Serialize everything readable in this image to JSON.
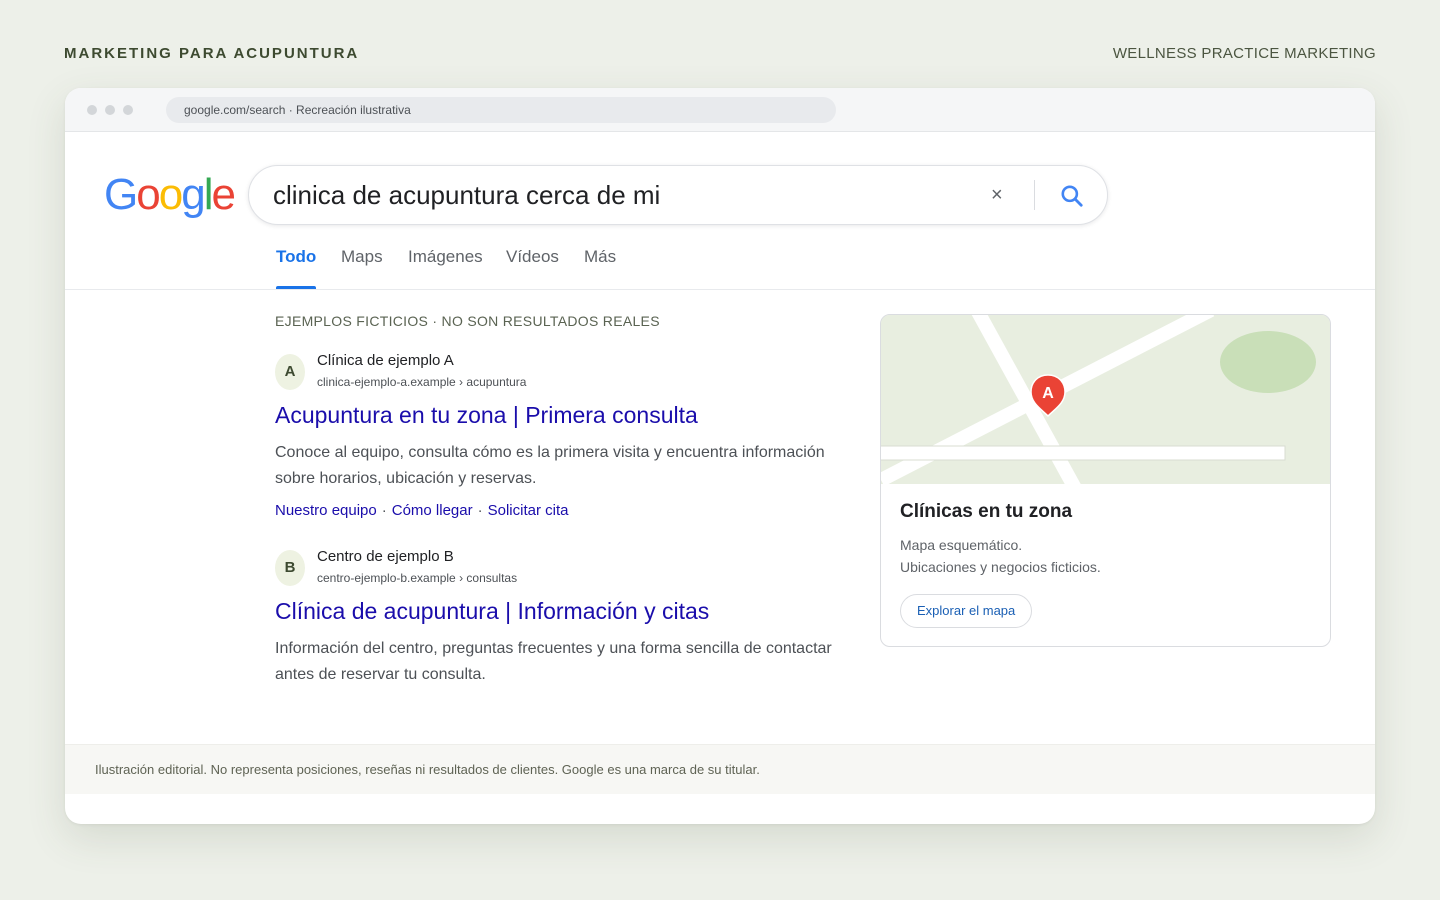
{
  "header": {
    "left_label": "MARKETING PARA ACUPUNTURA",
    "right_label": "WELLNESS PRACTICE MARKETING"
  },
  "browser": {
    "url": "google.com/search · Recreación ilustrativa"
  },
  "logo": {
    "letters": [
      "G",
      "o",
      "o",
      "g",
      "l",
      "e"
    ],
    "colors": [
      "#4285f4",
      "#ea4335",
      "#fbbc05",
      "#4285f4",
      "#34a853",
      "#ea4335"
    ]
  },
  "search": {
    "query": "clinica de acupuntura cerca de mi",
    "clear_icon": "×"
  },
  "tabs": [
    {
      "label": "Todo",
      "active": true
    },
    {
      "label": "Maps",
      "active": false
    },
    {
      "label": "Imágenes",
      "active": false
    },
    {
      "label": "Vídeos",
      "active": false
    },
    {
      "label": "Más",
      "active": false
    }
  ],
  "results_note": "EJEMPLOS FICTICIOS · NO SON RESULTADOS REALES",
  "results": [
    {
      "letter": "A",
      "site_name": "Clínica de ejemplo A",
      "site_url": "clinica-ejemplo-a.example › acupuntura",
      "title": "Acupuntura en tu zona | Primera consulta",
      "snippet": "Conoce al equipo, consulta cómo es la primera visita y encuentra información sobre horarios, ubicación y reservas.",
      "sitelinks": [
        "Nuestro equipo",
        "Cómo llegar",
        "Solicitar cita"
      ],
      "sitelink_separator": "·"
    },
    {
      "letter": "B",
      "site_name": "Centro de ejemplo B",
      "site_url": "centro-ejemplo-b.example › consultas",
      "title": "Clínica de acupuntura | Información y citas",
      "snippet": "Información del centro, preguntas frecuentes y una forma sencilla de contactar antes de reservar tu consulta."
    }
  ],
  "map_card": {
    "pin_label": "A",
    "title": "Clínicas en tu zona",
    "desc_line1": "Mapa esquemático.",
    "desc_line2": "Ubicaciones y negocios ficticios.",
    "button_label": "Explorar el mapa",
    "colors": {
      "land": "#e8eee0",
      "park": "#c9dfb8",
      "pin": "#ea4335",
      "road": "#ffffff"
    }
  },
  "footer": {
    "text": "Ilustración editorial. No representa posiciones, reseñas ni resultados de clientes. Google es una marca de su titular."
  }
}
